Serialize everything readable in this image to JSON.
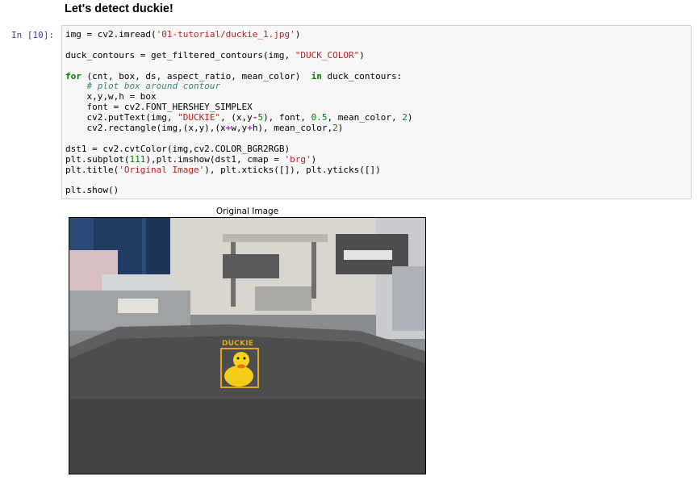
{
  "markdown": {
    "heading": "Let's detect duckie!"
  },
  "cell": {
    "prompt": "In [10]:",
    "lines": [
      [
        [
          "plain",
          "img = cv2.imread("
        ],
        [
          "str",
          "'01-tutorial/duckie_1.jpg'"
        ],
        [
          "plain",
          ")"
        ]
      ],
      [],
      [
        [
          "plain",
          "duck_contours = get_filtered_contours(img, "
        ],
        [
          "str",
          "\"DUCK_COLOR\""
        ],
        [
          "plain",
          ")"
        ]
      ],
      [],
      [
        [
          "kw",
          "for"
        ],
        [
          "plain",
          " (cnt, box, ds, aspect_ratio, mean_color)  "
        ],
        [
          "kw",
          "in"
        ],
        [
          "plain",
          " duck_contours:"
        ]
      ],
      [
        [
          "plain",
          "    "
        ],
        [
          "com",
          "# plot box around contour"
        ]
      ],
      [
        [
          "plain",
          "    x,y,w,h = box"
        ]
      ],
      [
        [
          "plain",
          "    font = cv2.FONT_HERSHEY_SIMPLEX"
        ]
      ],
      [
        [
          "plain",
          "    cv2.putText(img, "
        ],
        [
          "str",
          "\"DUCKIE\""
        ],
        [
          "plain",
          ", (x,y"
        ],
        [
          "op",
          "-"
        ],
        [
          "num",
          "5"
        ],
        [
          "plain",
          "), font, "
        ],
        [
          "num",
          "0.5"
        ],
        [
          "plain",
          ", mean_color, "
        ],
        [
          "num",
          "2"
        ],
        [
          "plain",
          ")"
        ]
      ],
      [
        [
          "plain",
          "    cv2.rectangle(img,(x,y),(x"
        ],
        [
          "op",
          "+"
        ],
        [
          "plain",
          "w,y"
        ],
        [
          "op",
          "+"
        ],
        [
          "plain",
          "h), mean_color,"
        ],
        [
          "num",
          "2"
        ],
        [
          "plain",
          ")"
        ]
      ],
      [],
      [
        [
          "plain",
          "dst1 = cv2.cvtColor(img,cv2.COLOR_BGR2RGB)"
        ]
      ],
      [
        [
          "plain",
          "plt.subplot("
        ],
        [
          "num",
          "111"
        ],
        [
          "plain",
          "),plt.imshow(dst1, cmap = "
        ],
        [
          "str",
          "'brg'"
        ],
        [
          "plain",
          ")"
        ]
      ],
      [
        [
          "plain",
          "plt.title("
        ],
        [
          "str",
          "'Original Image'"
        ],
        [
          "plain",
          "), plt.xticks([]), plt.yticks([])"
        ]
      ],
      [],
      [
        [
          "plain",
          "plt.show()"
        ]
      ]
    ]
  },
  "output": {
    "plot_title": "Original Image",
    "detection_label": "DUCKIE",
    "box_color": "#e6a21c"
  }
}
